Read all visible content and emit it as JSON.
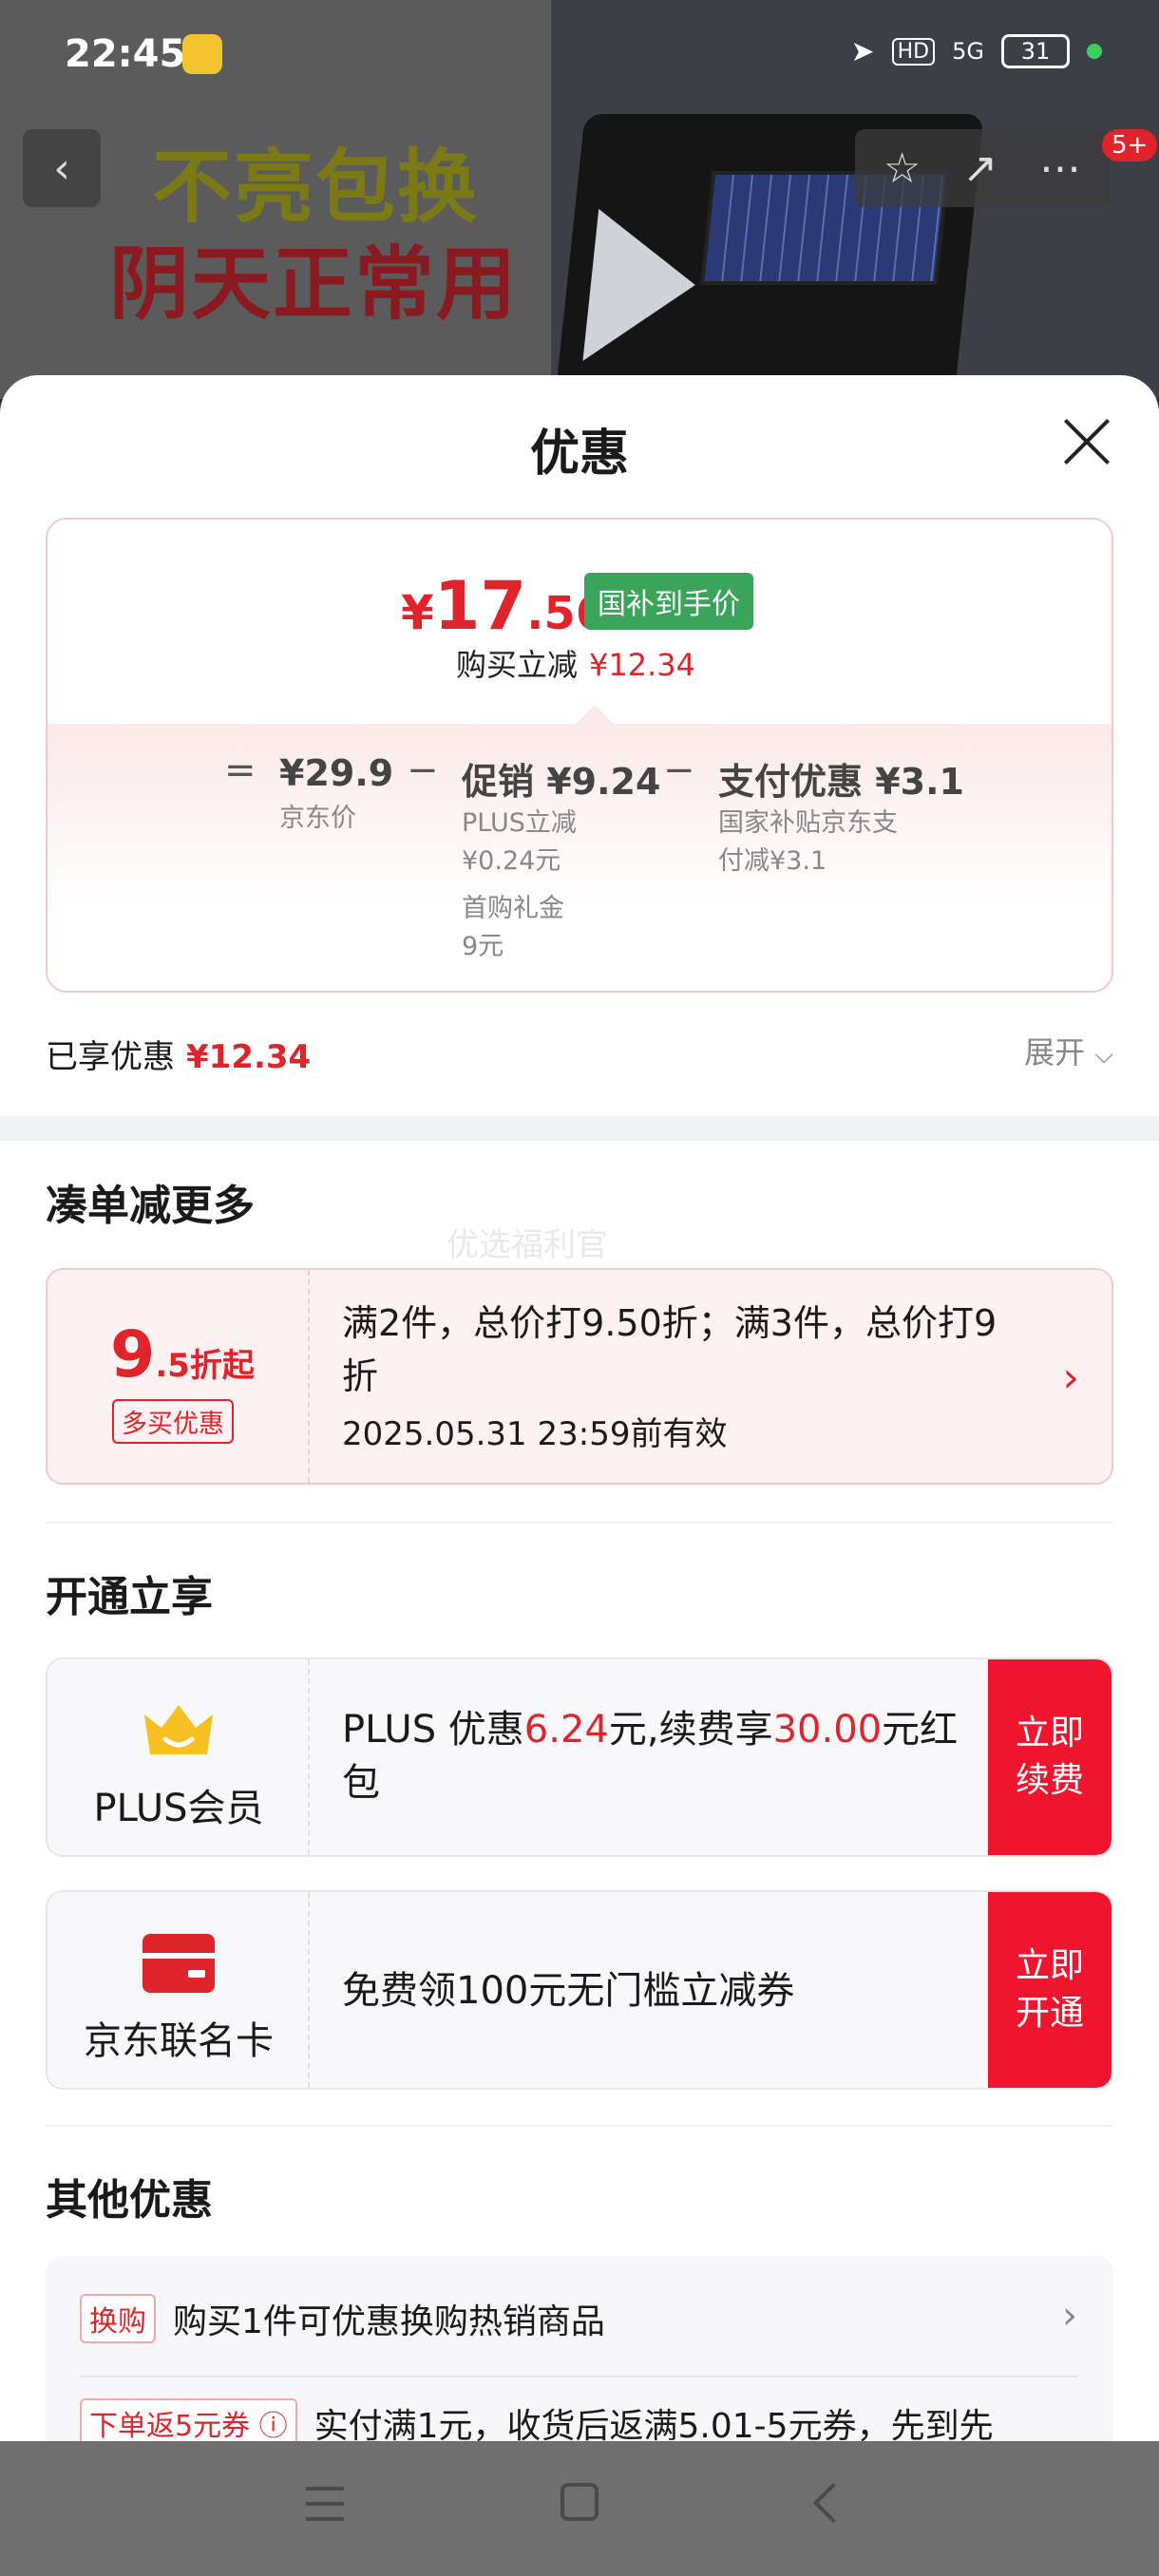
{
  "status_bar": {
    "time": "22:45",
    "battery": "31",
    "hd": "HD",
    "network": "5G"
  },
  "backdrop": {
    "ad_line1": "不亮包换",
    "ad_line2": "阴天正常用"
  },
  "header": {
    "notification_count": "5+"
  },
  "sheet": {
    "title": "优惠"
  },
  "price": {
    "currency": "¥",
    "final_int": "17",
    "final_dec": ".56",
    "tag": "国补到手价",
    "reduce_label": "购买立减",
    "reduce_value": "¥12.34",
    "equals": "=",
    "minus": "−",
    "base_amount": "¥29.9",
    "base_label": "京东价",
    "promo_title": "促销 ¥9.24",
    "promo_item1": "PLUS立减",
    "promo_item1_value": "¥0.24元",
    "promo_item2": "首购礼金",
    "promo_item2_value": "9元",
    "pay_title": "支付优惠 ¥3.1",
    "pay_item1": "国家补贴京东支",
    "pay_item1b": "付减¥3.1"
  },
  "applied": {
    "label": "已享优惠",
    "value": "¥12.34",
    "expand": "展开"
  },
  "bundle_section": {
    "title": "凑单减更多",
    "watermark": "优选福利官",
    "discount_big": "9",
    "discount_small": ".5折起",
    "tag": "多买优惠",
    "desc": "满2件，总价打9.50折；满3件，总价打9折",
    "valid": "2025.05.31 23:59前有效"
  },
  "open_section": {
    "title": "开通立享",
    "plus": {
      "label": "PLUS会员",
      "text_a": "PLUS 优惠",
      "amount1": "6.24",
      "text_b": "元,续费享",
      "amount2": "30.00",
      "text_c": "元红包",
      "cta_line1": "立即",
      "cta_line2": "续费"
    },
    "card": {
      "label": "京东联名卡",
      "text": "免费领100元无门槛立减券",
      "cta_line1": "立即",
      "cta_line2": "开通"
    }
  },
  "other_section": {
    "title": "其他优惠",
    "row1_tag": "换购",
    "row1_text": "购买1件可优惠换购热销商品",
    "row2_tag": "下单返5元券 ⓘ",
    "row2_text": "实付满1元，收货后返满5.01-5元券，先到先"
  },
  "colors": {
    "accent": "#e0242c",
    "green": "#3aa55a",
    "cta": "#f0152e"
  }
}
